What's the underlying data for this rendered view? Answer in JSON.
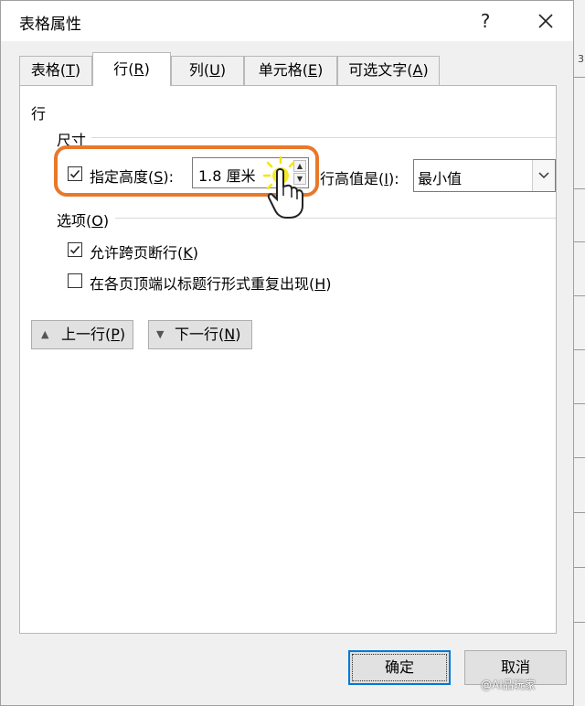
{
  "window": {
    "title": "表格属性",
    "help_label": "?",
    "close_icon": "close-icon"
  },
  "tabs": [
    {
      "label": "表格",
      "key": "T",
      "active": false
    },
    {
      "label": "行",
      "key": "R",
      "active": true
    },
    {
      "label": "列",
      "key": "U",
      "active": false
    },
    {
      "label": "单元格",
      "key": "E",
      "active": false
    },
    {
      "label": "可选文字",
      "key": "A",
      "active": false
    }
  ],
  "row_panel": {
    "heading": "行",
    "size": {
      "legend": "尺寸",
      "specify_height": {
        "label": "指定高度",
        "key": "S",
        "checked": true
      },
      "height_value": "1.8 厘米",
      "row_height_is": {
        "label": "行高值是",
        "key": "I"
      },
      "row_height_mode": "最小值"
    },
    "options": {
      "legend": "选项",
      "key": "O",
      "allow_break": {
        "label": "允许跨页断行",
        "key": "K",
        "checked": true
      },
      "repeat_header": {
        "label": "在各页顶端以标题行形式重复出现",
        "key": "H",
        "checked": false
      }
    },
    "prev_row": {
      "label": "上一行",
      "key": "P"
    },
    "next_row": {
      "label": "下一行",
      "key": "N"
    }
  },
  "footer": {
    "ok_label": "确定",
    "cancel_label": "取消"
  },
  "watermark": "@AI品玩家",
  "colors": {
    "highlight": "#e8782a",
    "default_button_border": "#0078d7",
    "cursor_glow": "#f5e600"
  }
}
